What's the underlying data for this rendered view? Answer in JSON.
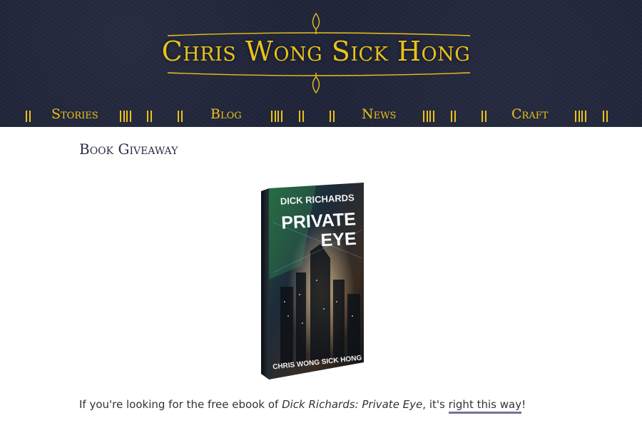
{
  "site": {
    "title": "Chris Wong Sick Hong"
  },
  "nav": {
    "items": [
      {
        "label": "Stories"
      },
      {
        "label": "Blog"
      },
      {
        "label": "News"
      },
      {
        "label": "Craft"
      }
    ]
  },
  "page": {
    "heading": "Book Giveaway"
  },
  "book": {
    "author_top": "DICK RICHARDS",
    "title_line1": "PRIVATE",
    "title_line2": "EYE",
    "author_bottom": "CHRIS WONG SICK HONG"
  },
  "intro": {
    "text_before": "If you're looking for the free ebook of ",
    "book_title": "Dick Richards: Private Eye",
    "text_middle": ", it's ",
    "link_label": "right this way",
    "text_after": "!"
  },
  "colors": {
    "header_bg": "#1f2338",
    "gold": "#e8c21c",
    "link_underline": "#7a6f98"
  },
  "icons": {
    "nav_separator": "double-bar"
  }
}
